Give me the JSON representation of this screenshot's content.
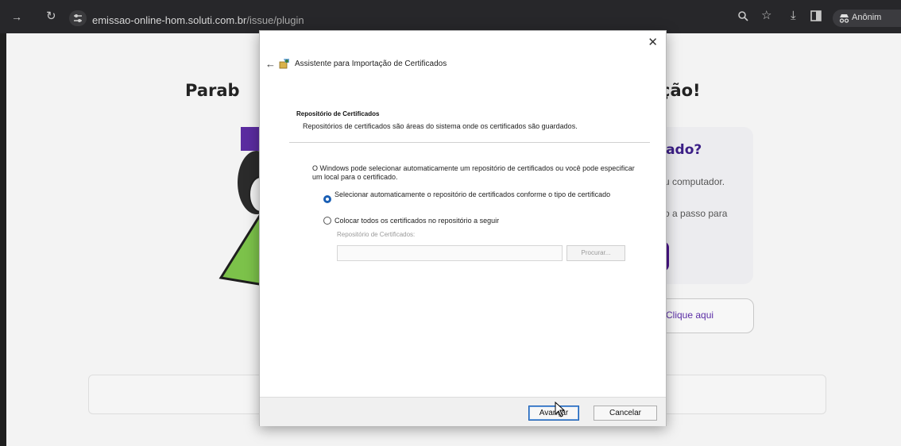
{
  "browser": {
    "url_host": "emissao-online-hom.soluti.com.br",
    "url_path": "/issue/plugin",
    "profile_label": "Anônim",
    "icons": [
      "forward-icon",
      "reload-icon",
      "site-settings-icon",
      "zoom-icon",
      "star-icon",
      "download-icon",
      "sidepanel-icon",
      "incognito-icon"
    ]
  },
  "page": {
    "heading_left": "Parab",
    "heading_right": "ção!",
    "card_title": "cado?",
    "card_line1": "u computador.",
    "card_line2": "o a passo para",
    "link_button": "Clique aqui"
  },
  "dialog": {
    "title": "Assistente para Importação de Certificados",
    "section_title": "Repositório de Certificados",
    "section_desc": "Repositórios de certificados são áreas do sistema onde os certificados são guardados.",
    "intro": "O Windows pode selecionar automaticamente um repositório de certificados ou você pode especificar um local para o certificado.",
    "option_auto": "Selecionar automaticamente o repositório de certificados conforme o tipo de certificado",
    "option_manual": "Colocar todos os certificados no repositório a seguir",
    "store_label": "Repositório de Certificados:",
    "store_value": "",
    "browse_button": "Procurar...",
    "next_button": "Avançar",
    "cancel_button": "Cancelar",
    "selected_option": "auto"
  }
}
